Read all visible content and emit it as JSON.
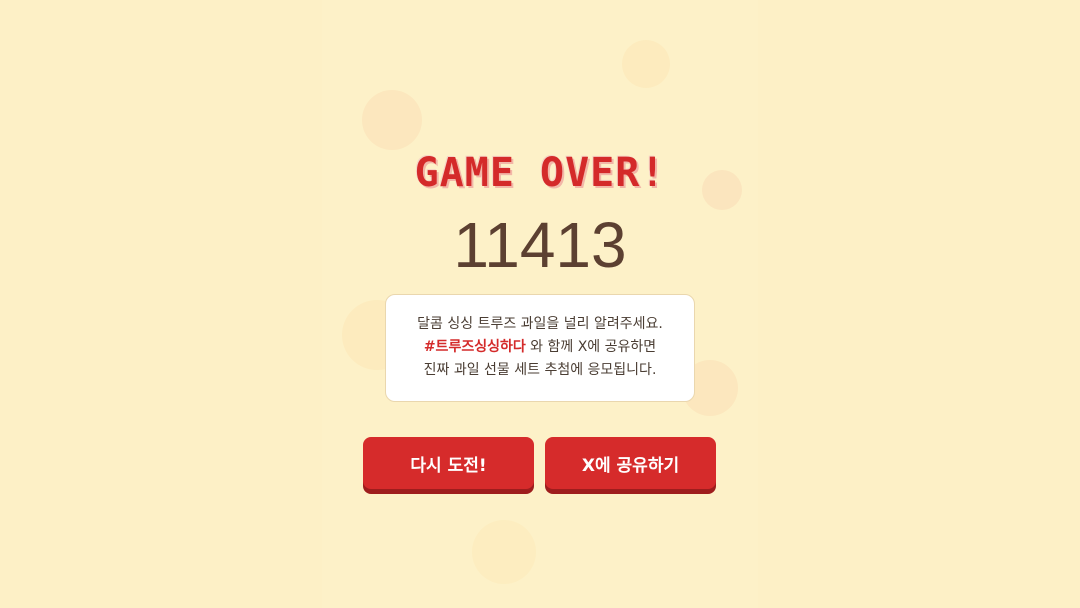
{
  "game_over": {
    "title": "GAME OVER!",
    "score": "11413"
  },
  "message": {
    "line1": "달콤 싱싱 트루즈 과일을 널리 알려주세요.",
    "hashtag": "#트루즈싱싱하다",
    "line2_rest": "와 함께 X에 공유하면",
    "line3": "진짜 과일 선물 세트 추첨에 응모됩니다."
  },
  "buttons": {
    "retry_label": "다시 도전!",
    "share_label": "X에 공유하기"
  },
  "colors": {
    "background": "#fdf0c6",
    "accent_red": "#d62b2b",
    "score_brown": "#5c4031"
  }
}
